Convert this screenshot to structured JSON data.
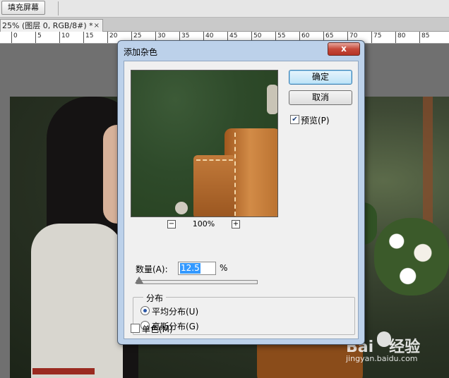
{
  "toolbar": {
    "fill_screen_label": "填充屏幕"
  },
  "document_tab": {
    "title": "25% (图层 0, RGB/8#) *",
    "close_glyph": "×"
  },
  "ruler": {
    "labels": [
      "0",
      "5",
      "10",
      "15",
      "20",
      "25",
      "30",
      "35",
      "40",
      "45",
      "50",
      "55",
      "60",
      "65",
      "70",
      "75",
      "80",
      "85"
    ]
  },
  "dialog": {
    "title": "添加杂色",
    "close_glyph": "x",
    "ok_label": "确定",
    "cancel_label": "取消",
    "preview_label": "预览(P)",
    "preview_checked": true,
    "zoom_level": "100%",
    "zoom_minus": "−",
    "zoom_plus": "+",
    "amount_label": "数量(A):",
    "amount_value": "12.5",
    "amount_unit": "%",
    "distribution_legend": "分布",
    "uniform_label": "平均分布(U)",
    "gaussian_label": "高斯分布(G)",
    "selected_distribution": "uniform",
    "monochrome_label": "单色(M)",
    "monochrome_checked": false
  },
  "watermark": {
    "brand": "Bai",
    "brand2": "经验",
    "url": "jingyan.baidu.com"
  }
}
